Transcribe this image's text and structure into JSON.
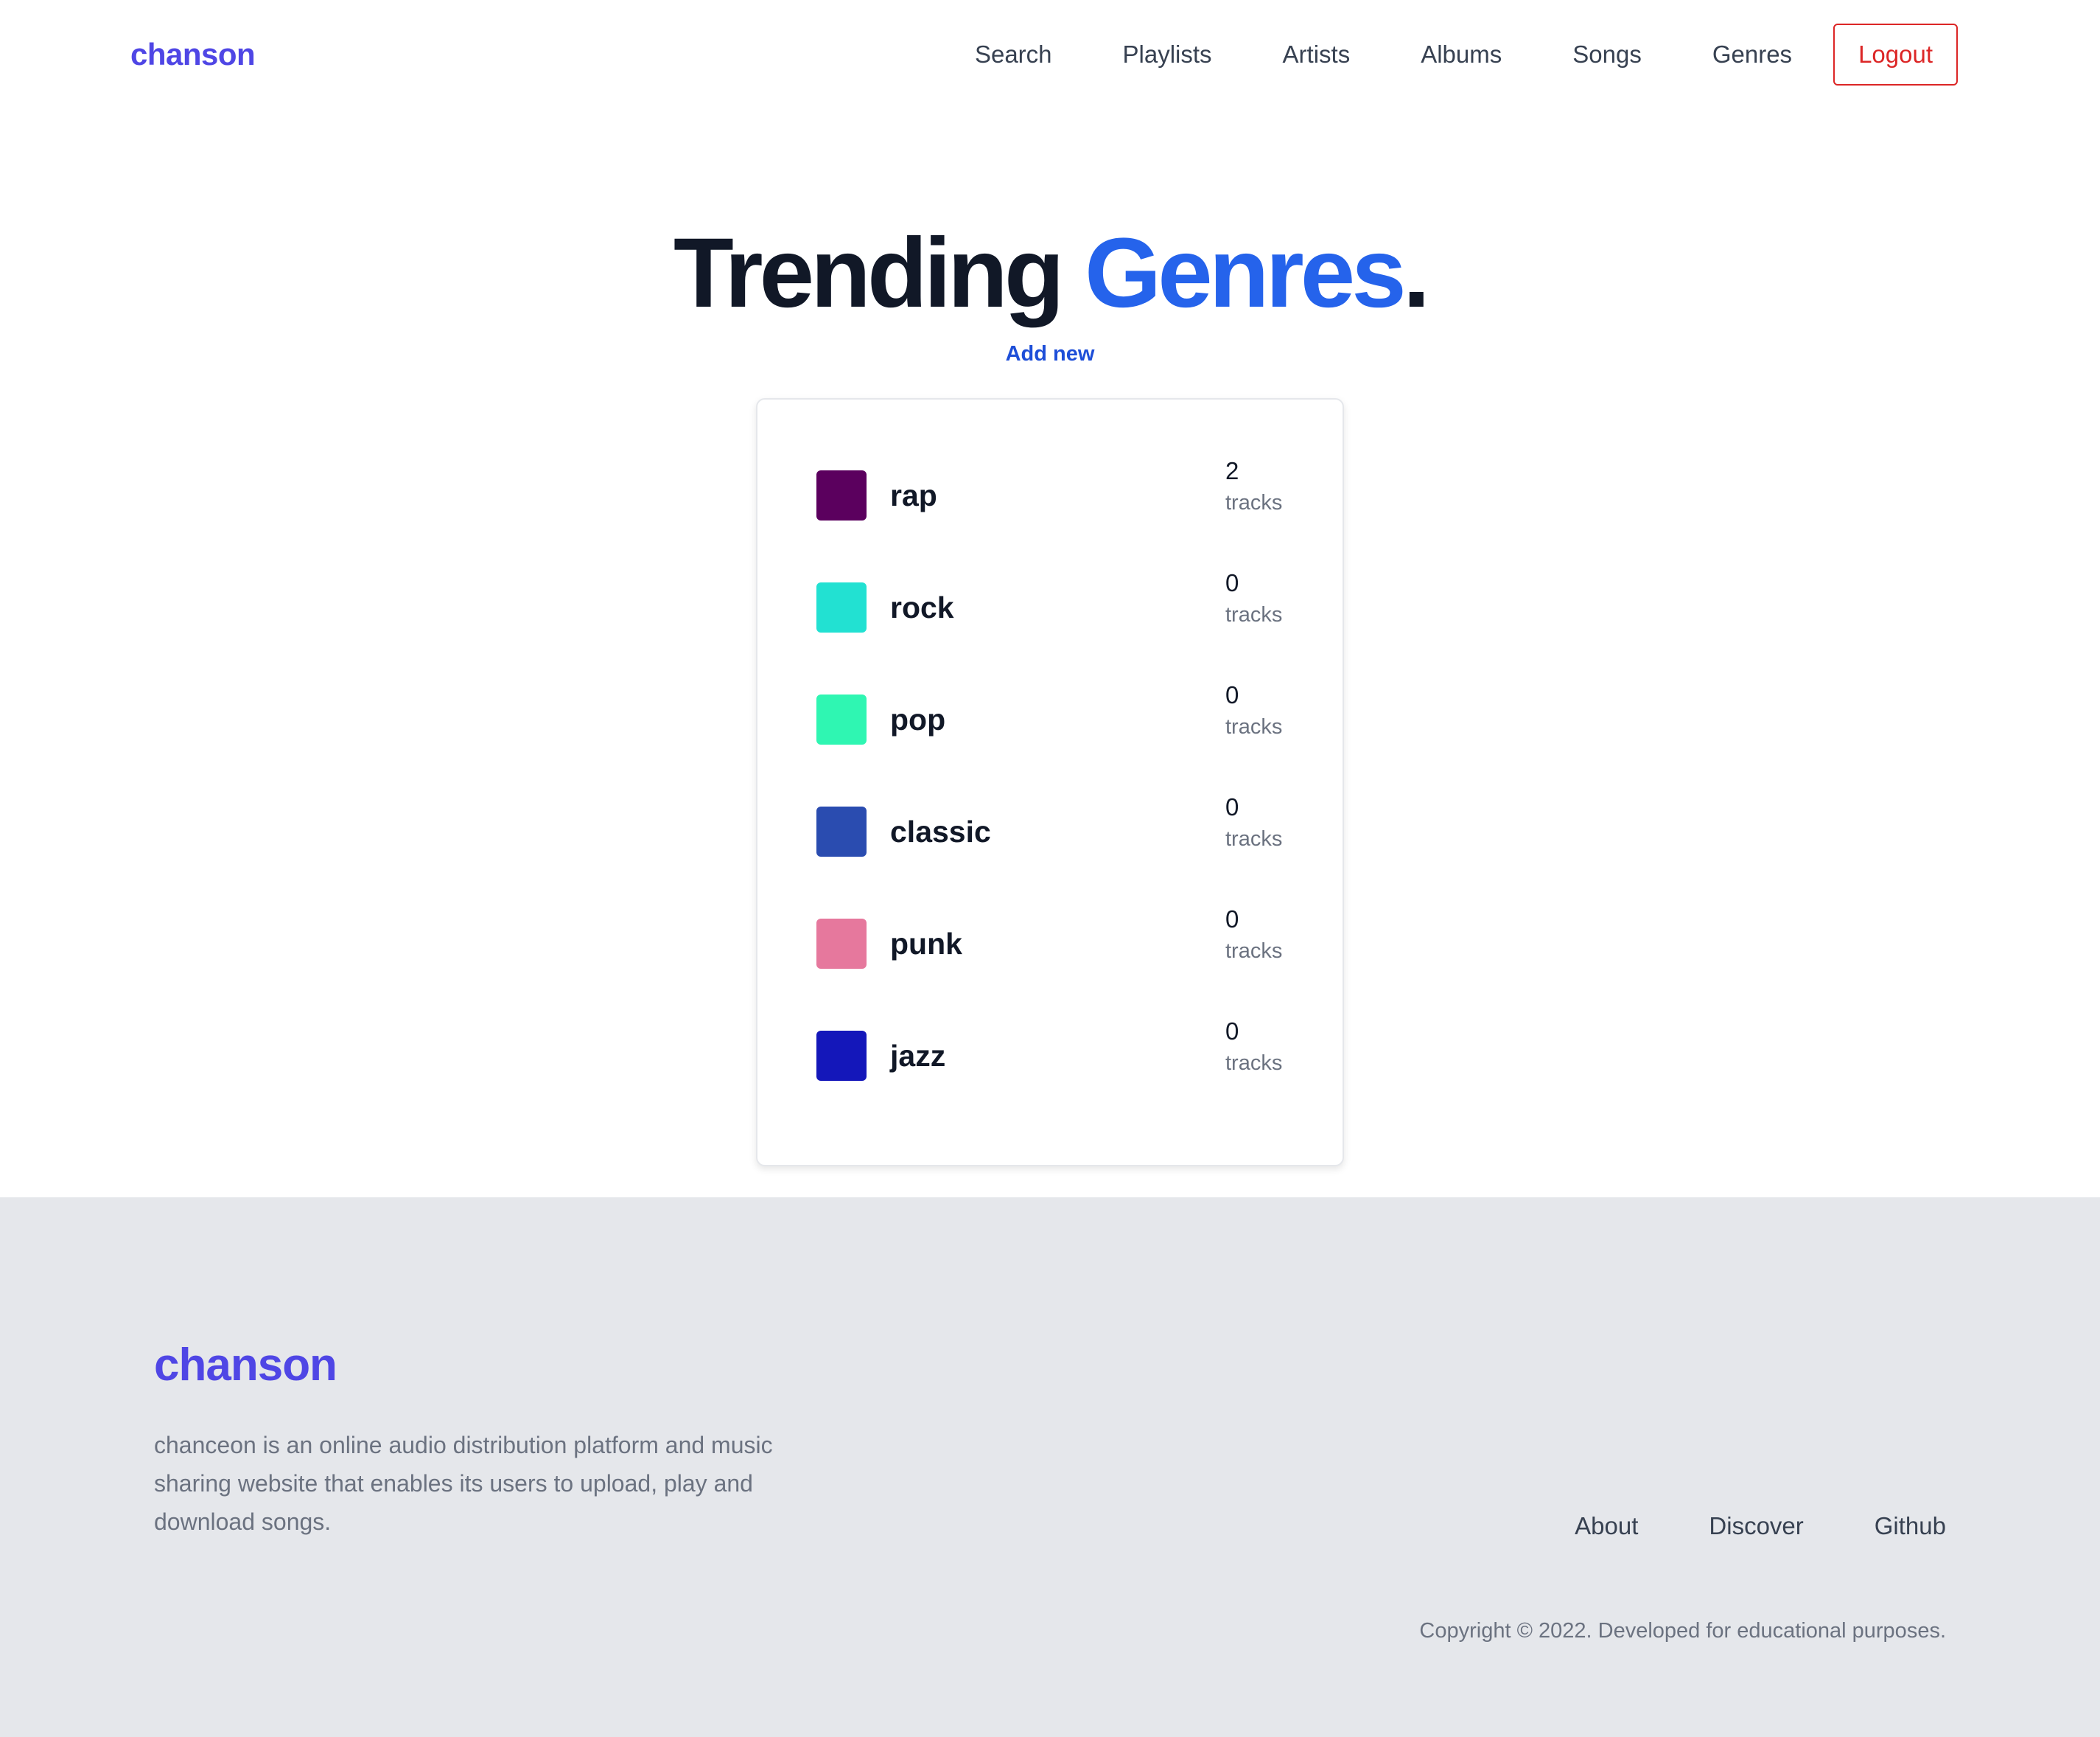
{
  "header": {
    "brand": "chanson",
    "nav": [
      "Search",
      "Playlists",
      "Artists",
      "Albums",
      "Songs",
      "Genres"
    ],
    "logout_label": "Logout"
  },
  "hero": {
    "title_main": "Trending ",
    "title_accent": "Genres",
    "title_end": ".",
    "add_new_label": "Add new"
  },
  "genres": [
    {
      "name": "rap",
      "count": "2",
      "unit": "tracks",
      "color": "#5b005e"
    },
    {
      "name": "rock",
      "count": "0",
      "unit": "tracks",
      "color": "#22e1d2"
    },
    {
      "name": "pop",
      "count": "0",
      "unit": "tracks",
      "color": "#2ff6b2"
    },
    {
      "name": "classic",
      "count": "0",
      "unit": "tracks",
      "color": "#2a4cb0"
    },
    {
      "name": "punk",
      "count": "0",
      "unit": "tracks",
      "color": "#e6789d"
    },
    {
      "name": "jazz",
      "count": "0",
      "unit": "tracks",
      "color": "#1417ba"
    }
  ],
  "footer": {
    "brand": "chanson",
    "description": "chanceon is an online audio distribution platform and music sharing website that enables its users to upload, play and download songs.",
    "links": [
      "About",
      "Discover",
      "Github"
    ],
    "copyright": "Copyright © 2022. Developed for educational purposes."
  },
  "colors": {
    "brand": "#4f46e5",
    "accent": "#2563eb",
    "logout": "#dc2626",
    "footer_bg": "#e5e7eb"
  }
}
